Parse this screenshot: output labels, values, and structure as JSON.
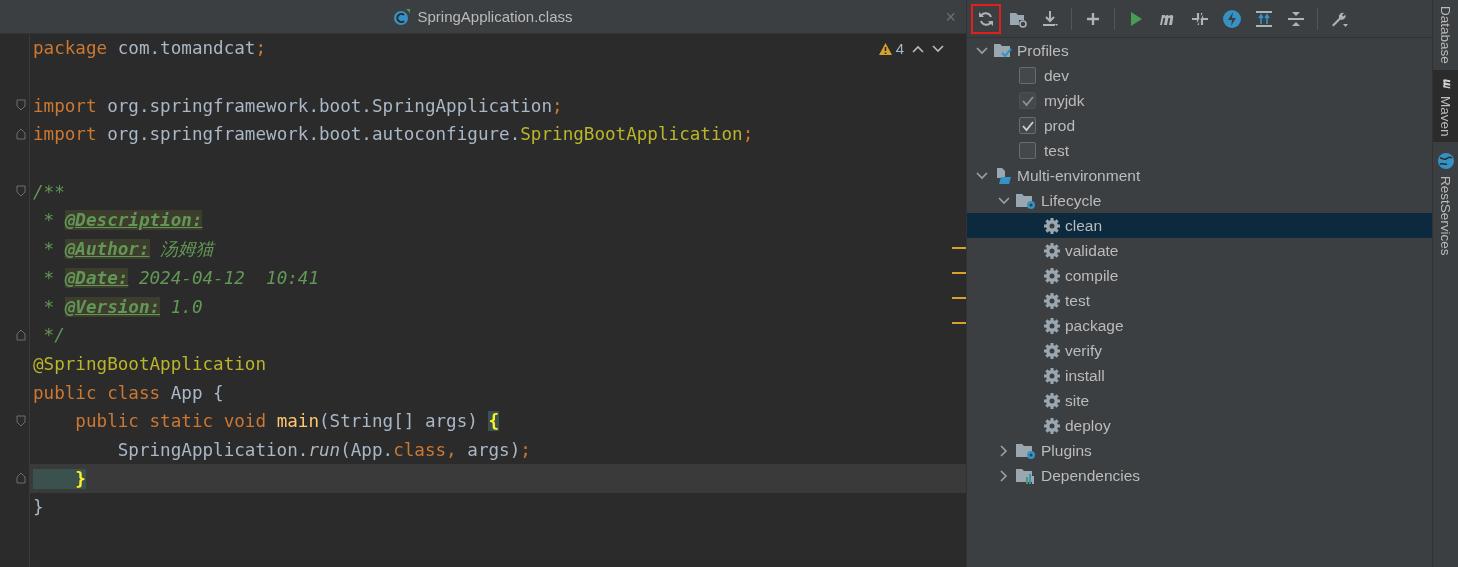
{
  "editor": {
    "tab": {
      "title": "SpringApplication.class",
      "close": "×"
    },
    "inspections": {
      "count": "4"
    },
    "lines": [
      {
        "kind": "plain",
        "current": false,
        "tokens": [
          {
            "kind": "kw",
            "text": "package "
          },
          {
            "kind": "plain",
            "text": "com.tomandcat"
          },
          {
            "kind": "kw",
            "text": ";"
          }
        ]
      },
      {
        "kind": "plain",
        "current": false
      },
      {
        "kind": "fold-start",
        "current": false,
        "tokens": [
          {
            "kind": "kw",
            "text": "import "
          },
          {
            "kind": "plain",
            "text": "org.springframework.boot.SpringApplication"
          },
          {
            "kind": "kw",
            "text": ";"
          }
        ]
      },
      {
        "kind": "fold-end",
        "current": false,
        "tokens": [
          {
            "kind": "kw",
            "text": "import "
          },
          {
            "kind": "plain",
            "text": "org.springframework.boot.autoconfigure."
          },
          {
            "kind": "ann",
            "text": "SpringBootApplication"
          },
          {
            "kind": "kw",
            "text": ";"
          }
        ]
      },
      {
        "kind": "plain",
        "current": false
      },
      {
        "kind": "fold-start",
        "current": false,
        "tokens": [
          {
            "kind": "comment",
            "text": "/**"
          }
        ]
      },
      {
        "kind": "plain",
        "current": false,
        "tokens": [
          {
            "kind": "comment",
            "text": " * "
          },
          {
            "kind": "doctag",
            "text": "@Description:"
          }
        ]
      },
      {
        "kind": "plain",
        "current": false,
        "tokens": [
          {
            "kind": "comment",
            "text": " * "
          },
          {
            "kind": "doctag",
            "text": "@Author:"
          },
          {
            "kind": "comment",
            "text": " 汤姆猫"
          }
        ]
      },
      {
        "kind": "plain",
        "current": false,
        "tokens": [
          {
            "kind": "comment",
            "text": " * "
          },
          {
            "kind": "doctag",
            "text": "@Date:"
          },
          {
            "kind": "comment",
            "text": " 2024-04-12  10:41"
          }
        ]
      },
      {
        "kind": "plain",
        "current": false,
        "tokens": [
          {
            "kind": "comment",
            "text": " * "
          },
          {
            "kind": "doctag",
            "text": "@Version:"
          },
          {
            "kind": "comment",
            "text": " 1.0"
          }
        ]
      },
      {
        "kind": "fold-end",
        "current": false,
        "tokens": [
          {
            "kind": "comment",
            "text": " */"
          }
        ]
      },
      {
        "kind": "plain",
        "current": false,
        "tokens": [
          {
            "kind": "ann",
            "text": "@SpringBootApplication"
          }
        ]
      },
      {
        "kind": "plain",
        "current": false,
        "tokens": [
          {
            "kind": "kw",
            "text": "public class "
          },
          {
            "kind": "plain",
            "text": "App {"
          }
        ]
      },
      {
        "kind": "fold-start",
        "current": false,
        "tokens": [
          {
            "kind": "kw",
            "text": "    public static void "
          },
          {
            "kind": "method",
            "text": "main"
          },
          {
            "kind": "plain",
            "text": "(String[] args) "
          },
          {
            "kind": "brace",
            "text": "{"
          }
        ]
      },
      {
        "kind": "plain",
        "current": false,
        "tokens": [
          {
            "kind": "plain",
            "text": "        SpringApplication."
          },
          {
            "kind": "italic",
            "text": "run"
          },
          {
            "kind": "plain",
            "text": "(App."
          },
          {
            "kind": "kw",
            "text": "class, "
          },
          {
            "kind": "plain",
            "text": "args)"
          },
          {
            "kind": "kw",
            "text": ";"
          }
        ]
      },
      {
        "kind": "fold-end",
        "current": true,
        "tokens": [
          {
            "kind": "brace",
            "text": "    }"
          }
        ]
      },
      {
        "kind": "plain",
        "current": false,
        "tokens": [
          {
            "kind": "plain",
            "text": "}"
          }
        ]
      }
    ]
  },
  "maven": {
    "toolbar": [
      {
        "kind": "refresh",
        "highlighted": true
      },
      {
        "kind": "folder-refresh",
        "highlighted": false
      },
      {
        "kind": "download",
        "highlighted": false
      },
      {
        "kind": "sep"
      },
      {
        "kind": "add",
        "highlighted": false
      },
      {
        "kind": "sep"
      },
      {
        "kind": "run",
        "highlighted": false
      },
      {
        "kind": "maven",
        "highlighted": false
      },
      {
        "kind": "skip-tests",
        "highlighted": false
      },
      {
        "kind": "lightning",
        "highlighted": false
      },
      {
        "kind": "show-deps",
        "highlighted": false
      },
      {
        "kind": "collapse",
        "highlighted": false
      },
      {
        "kind": "sep"
      },
      {
        "kind": "wrench",
        "highlighted": false
      }
    ],
    "tree": [
      {
        "kind": "profiles",
        "label": "Profiles",
        "expanded": true,
        "selected": false,
        "children": [
          {
            "kind": "profile",
            "label": "dev",
            "checked": false,
            "disabled": false,
            "selected": false
          },
          {
            "kind": "profile",
            "label": "myjdk",
            "checked": true,
            "disabled": true,
            "selected": false
          },
          {
            "kind": "profile",
            "label": "prod",
            "checked": true,
            "disabled": false,
            "selected": false
          },
          {
            "kind": "profile",
            "label": "test",
            "checked": false,
            "disabled": false,
            "selected": false
          }
        ]
      },
      {
        "kind": "project",
        "label": "Multi-environment",
        "expanded": true,
        "selected": false,
        "children": [
          {
            "kind": "lifecycle",
            "label": "Lifecycle",
            "expanded": true,
            "selected": false,
            "children": [
              {
                "kind": "goal",
                "label": "clean",
                "selected": true
              },
              {
                "kind": "goal",
                "label": "validate",
                "selected": false
              },
              {
                "kind": "goal",
                "label": "compile",
                "selected": false
              },
              {
                "kind": "goal",
                "label": "test",
                "selected": false
              },
              {
                "kind": "goal",
                "label": "package",
                "selected": false
              },
              {
                "kind": "goal",
                "label": "verify",
                "selected": false
              },
              {
                "kind": "goal",
                "label": "install",
                "selected": false
              },
              {
                "kind": "goal",
                "label": "site",
                "selected": false
              },
              {
                "kind": "goal",
                "label": "deploy",
                "selected": false
              }
            ]
          },
          {
            "kind": "plugins",
            "label": "Plugins",
            "expanded": false,
            "selected": false
          },
          {
            "kind": "dependencies",
            "label": "Dependencies",
            "expanded": false,
            "selected": false
          }
        ]
      }
    ]
  },
  "side_tabs": [
    {
      "kind": "database",
      "label": "Database",
      "selected": false
    },
    {
      "kind": "maven",
      "label": "Maven",
      "selected": true
    },
    {
      "kind": "rest",
      "label": "RestServices",
      "selected": false
    }
  ]
}
